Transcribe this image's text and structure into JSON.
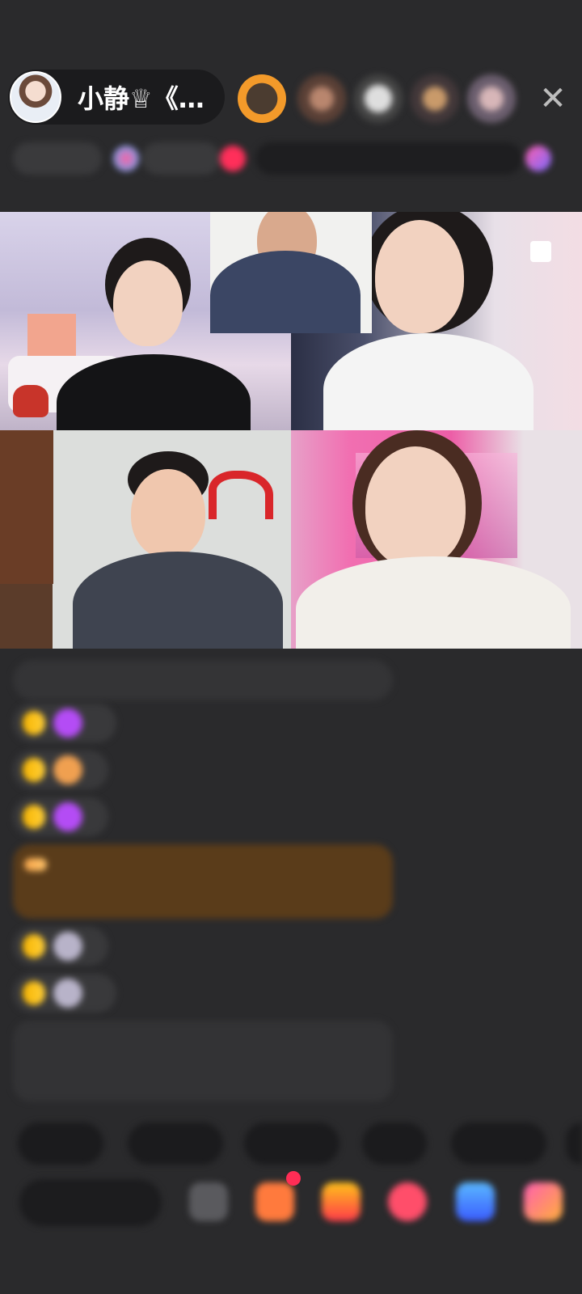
{
  "header": {
    "host_name": "小静♕《…",
    "close_icon": "close-icon",
    "viewer_count": 5,
    "info_chips": [
      "Sun",
      "0",
      "0",
      "",
      "",
      "",
      "",
      ""
    ]
  },
  "video_tiles": [
    {
      "id": "top-left"
    },
    {
      "id": "top-center-small"
    },
    {
      "id": "top-right"
    },
    {
      "id": "bottom-left"
    },
    {
      "id": "bottom-right"
    }
  ],
  "chat": {
    "notice": "",
    "messages": [
      {
        "badge": "",
        "icon": "gem-icon",
        "user": "",
        "extra": "",
        "text": ""
      },
      {
        "badge": "",
        "icon": "badge-icon",
        "user": "",
        "extra": "",
        "text": ""
      },
      {
        "badge": "",
        "icon": "gem-icon",
        "user": "",
        "extra": "",
        "text": ""
      },
      {
        "badge": "",
        "icon": "",
        "user": "",
        "extra": "",
        "text": ""
      },
      {
        "badge": "",
        "icon": "avatar-icon",
        "user": "",
        "extra": "",
        "text": ""
      },
      {
        "badge": "",
        "icon": "avatar-icon",
        "user": "",
        "extra": "",
        "text": ""
      }
    ],
    "system_message": ""
  },
  "quick_replies": [
    "",
    "",
    "",
    "",
    ""
  ],
  "bottom_bar": {
    "input_placeholder": "",
    "icons": [
      "emoji-icon",
      "gift-box-icon",
      "gift-icon",
      "heart-icon",
      "game-icon",
      "apps-icon"
    ]
  }
}
